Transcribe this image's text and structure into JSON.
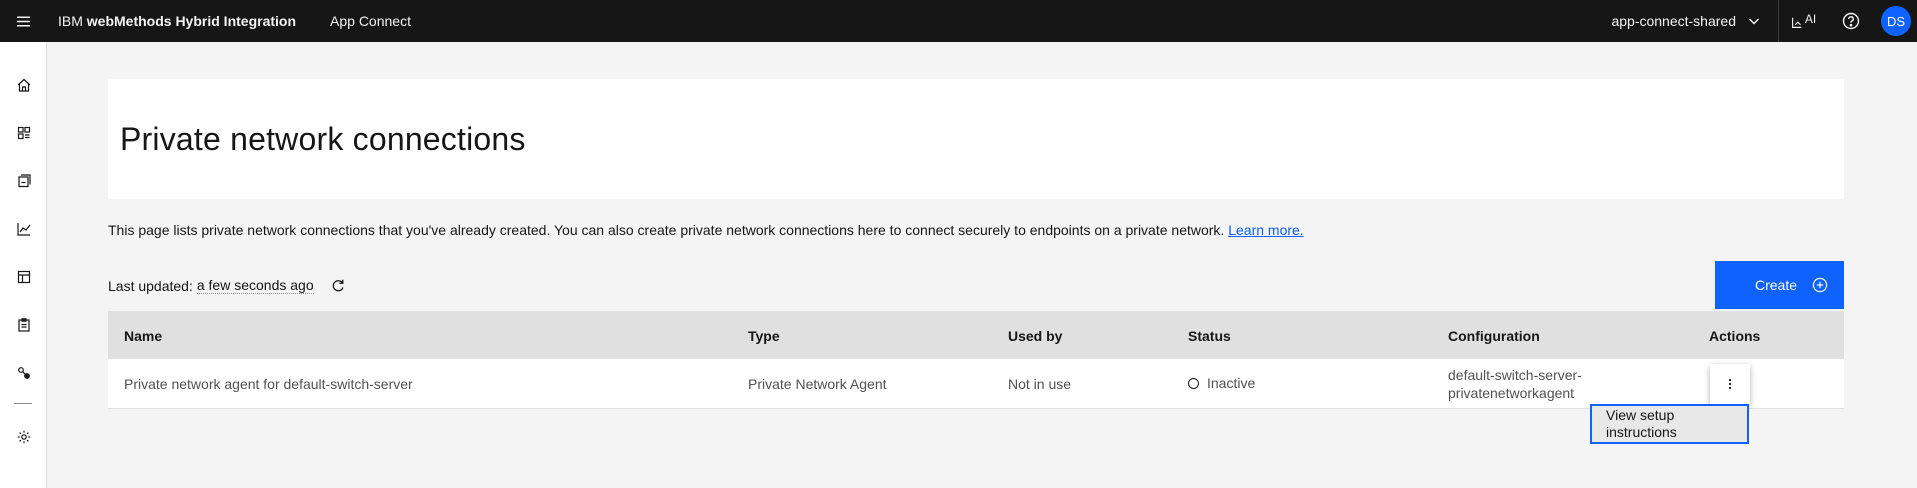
{
  "header": {
    "brand_prefix": "IBM",
    "brand_name": "webMethods Hybrid Integration",
    "app_name": "App Connect",
    "instance": "app-connect-shared",
    "ai_label": "AI",
    "avatar_initials": "DS"
  },
  "sidenav": {
    "items": [
      {
        "icon": "home-icon"
      },
      {
        "icon": "dashboard-icon"
      },
      {
        "icon": "catalog-icon"
      },
      {
        "icon": "analytics-icon"
      },
      {
        "icon": "templates-icon"
      },
      {
        "icon": "clipboard-icon"
      },
      {
        "icon": "connections-icon"
      },
      {
        "icon": "settings-icon"
      }
    ]
  },
  "page": {
    "title": "Private network connections",
    "description": "This page lists private network connections that you've already created. You can also create private network connections here to connect securely to endpoints on a private network.",
    "learn_more": "Learn more.",
    "last_updated_label": "Last updated:",
    "last_updated_value": "a few seconds ago",
    "create_label": "Create"
  },
  "table": {
    "columns": [
      "Name",
      "Type",
      "Used by",
      "Status",
      "Configuration",
      "Actions"
    ],
    "rows": [
      {
        "name": "Private network agent for default-switch-server",
        "type": "Private Network Agent",
        "used_by": "Not in use",
        "status": "Inactive",
        "config_line1": "default-switch-server-",
        "config_line2": "privatenetworkagent"
      }
    ]
  },
  "menu": {
    "item": "View setup instructions"
  },
  "colors": {
    "header_bg": "#161616",
    "primary": "#0f62fe",
    "table_header": "#e0e0e0",
    "page_bg": "#f4f4f4"
  }
}
